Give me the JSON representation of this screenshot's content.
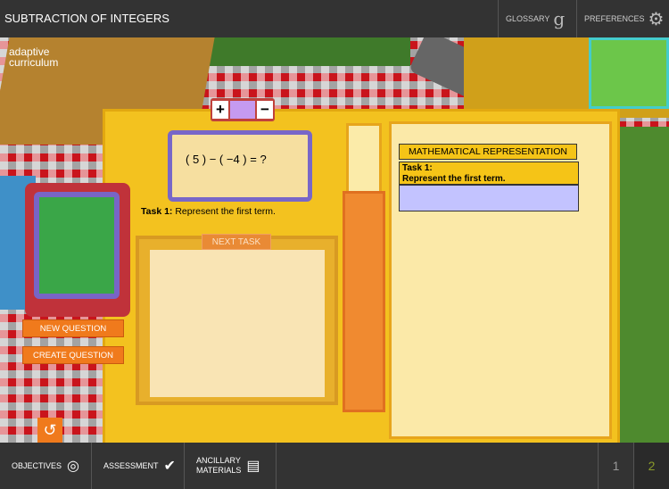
{
  "header": {
    "title": "SUBTRACTION OF INTEGERS",
    "glossary": "GLOSSARY",
    "preferences": "PREFERENCES"
  },
  "logo": {
    "line1": "adaptive",
    "line2": "curriculum"
  },
  "workspace": {
    "sign_plus": "+",
    "sign_minus": "−",
    "equation": "( 5 ) − ( −4 ) = ?",
    "task_label": "Task 1:",
    "task_text": "Represent the first term.",
    "next_task": "NEXT TASK",
    "new_question": "NEW QUESTION",
    "create_question": "CREATE QUESTION"
  },
  "math_panel": {
    "title": "MATHEMATICAL REPRESENTATION",
    "task_label": "Task 1:",
    "task_text": "Represent the first term."
  },
  "footer": {
    "objectives": "OBJECTIVES",
    "assessment": "ASSESSMENT",
    "ancillary_1": "ANCILLARY",
    "ancillary_2": "MATERIALS",
    "pages": [
      "1",
      "2"
    ],
    "current_page": "2"
  },
  "colors": {
    "accent_orange": "#f07a1c",
    "board_yellow": "#f3c21f",
    "panel_lavender": "#c3c3ff",
    "active_page": "#8a9a2a"
  }
}
